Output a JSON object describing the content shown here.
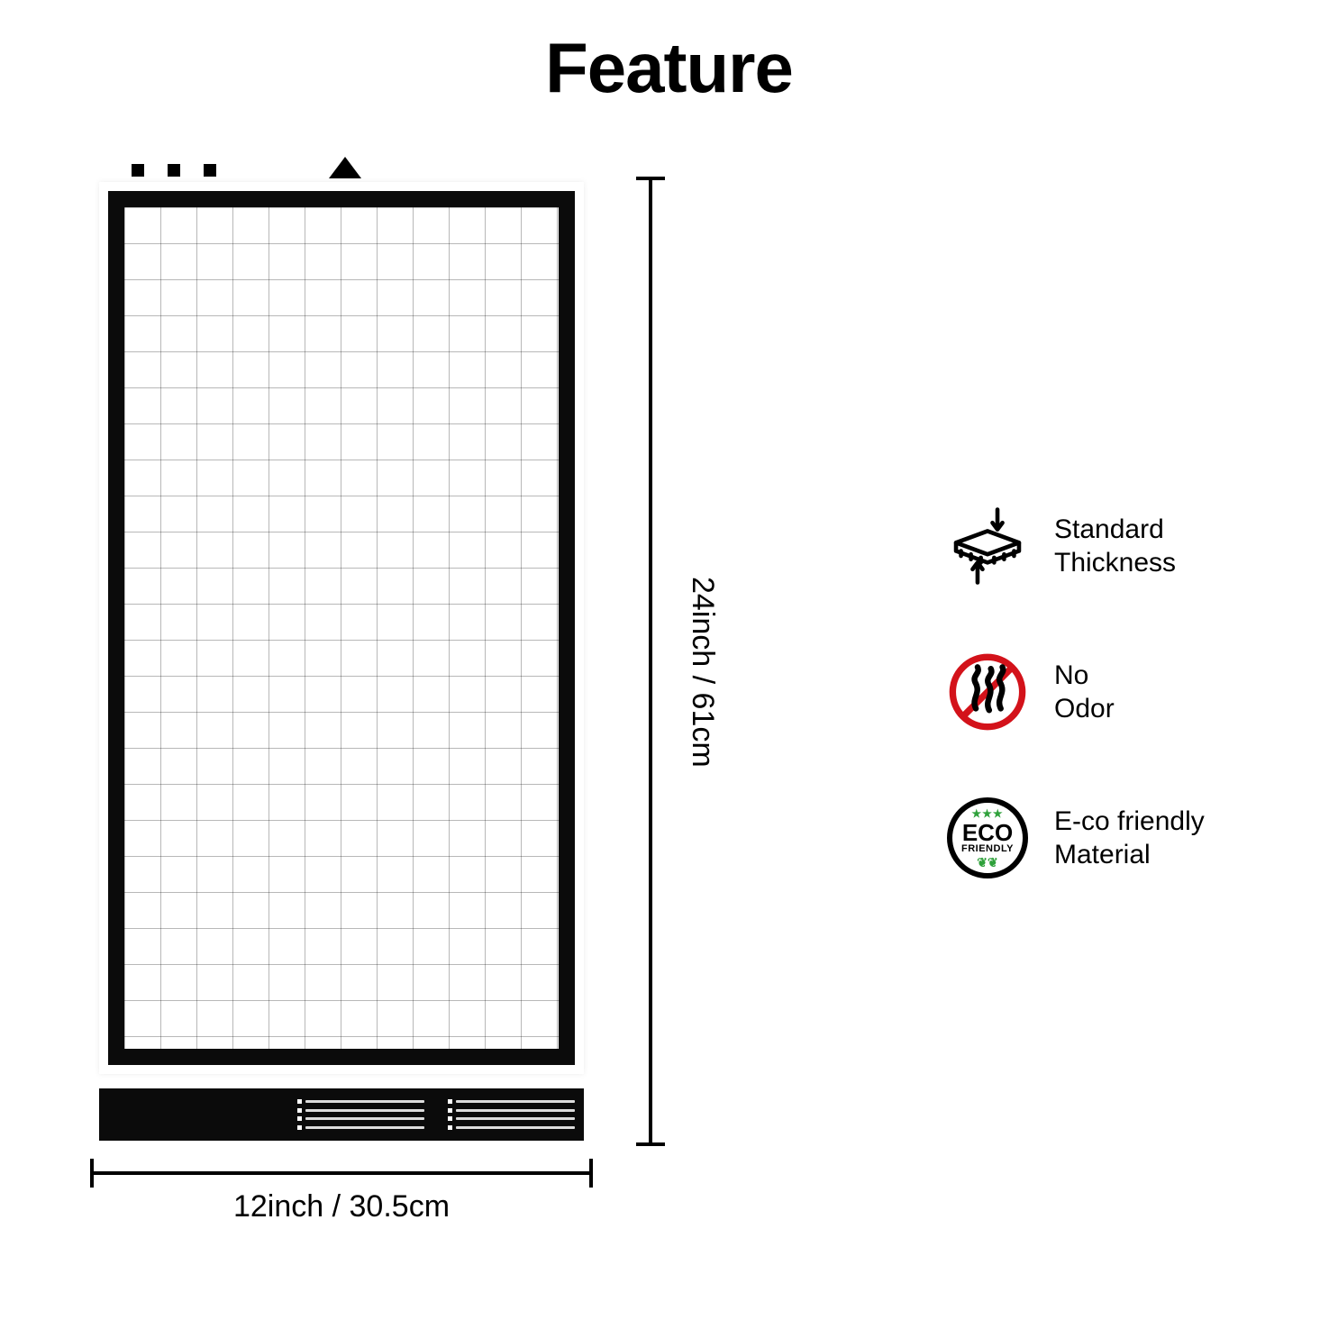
{
  "title": "Feature",
  "dimensions": {
    "width_label": "12inch / 30.5cm",
    "height_label": "24inch / 61cm"
  },
  "feature_list": [
    {
      "icon": "thickness-icon",
      "line1": "Standard",
      "line2": "Thickness"
    },
    {
      "icon": "no-odor-icon",
      "line1": "No",
      "line2": "Odor"
    },
    {
      "icon": "eco-icon",
      "line1": "E-co friendly",
      "line2": "Material"
    }
  ],
  "eco_badge": {
    "top": "ECO",
    "bottom": "FRIENDLY"
  }
}
